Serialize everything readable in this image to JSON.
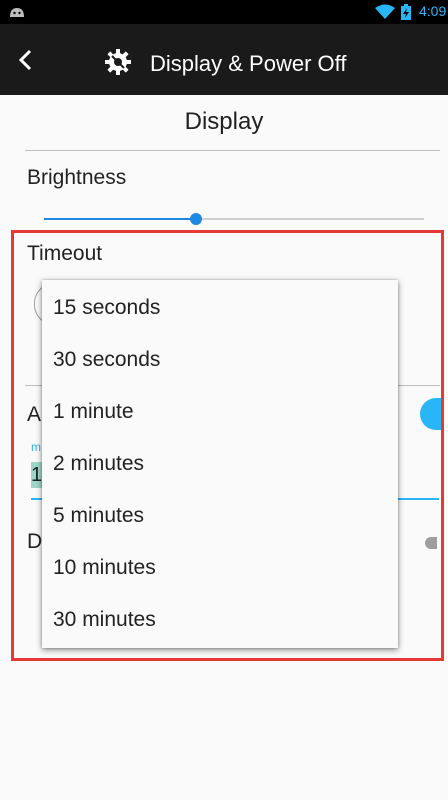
{
  "status_bar": {
    "time": "4:09",
    "icons": [
      "android-icon",
      "wifi-icon",
      "battery-charging-icon"
    ],
    "accent_color": "#29b6f6"
  },
  "app_bar": {
    "title": "Display & Power Off",
    "back_icon": "chevron-left-icon",
    "app_icon": "gear-icon"
  },
  "section": {
    "title": "Display"
  },
  "brightness": {
    "label": "Brightness",
    "level": 0.4
  },
  "timeout": {
    "label": "Timeout",
    "options": [
      "15 seconds",
      "30 seconds",
      "1 minute",
      "2 minutes",
      "5 minutes",
      "10 minutes",
      "30 minutes"
    ]
  },
  "underlying": {
    "auto_label_partial": "A",
    "hint_partial": "m",
    "input_partial": "1",
    "d_label_partial": "D"
  },
  "colors": {
    "accent": "#1e88e5",
    "highlight": "#e53935"
  }
}
